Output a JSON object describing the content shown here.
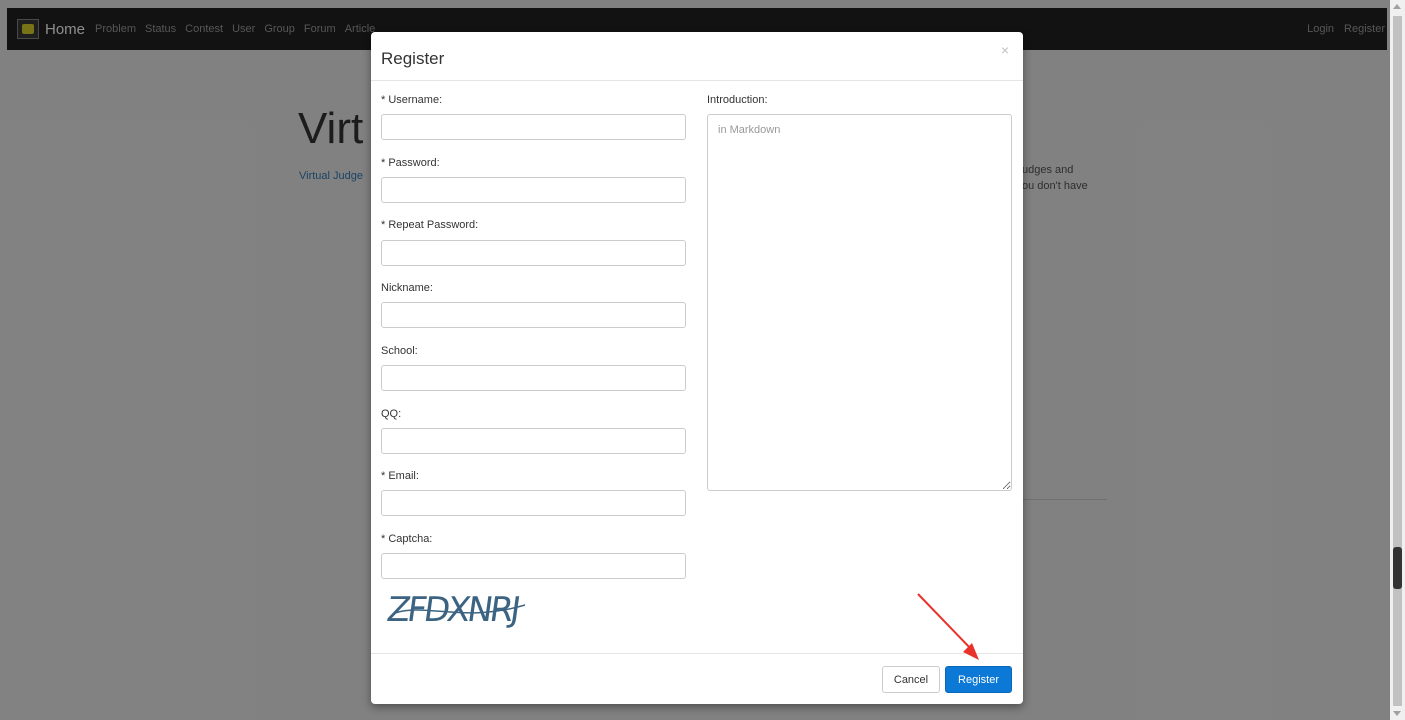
{
  "navbar": {
    "brand": "Home",
    "items": [
      "Problem",
      "Status",
      "Contest",
      "User",
      "Group",
      "Forum",
      "Article"
    ],
    "right_items": [
      "Login",
      "Register"
    ]
  },
  "background": {
    "title": "Virt",
    "description": "Virtual Judge",
    "side_line_1": "udges and",
    "side_line_2": "ou don't have"
  },
  "modal": {
    "title": "Register",
    "close": "×",
    "fields": {
      "username_label": "* Username:",
      "password_label": "* Password:",
      "repeat_password_label": "* Repeat Password:",
      "nickname_label": "Nickname:",
      "school_label": "School:",
      "qq_label": "QQ:",
      "email_label": "* Email:",
      "captcha_label": "* Captcha:",
      "introduction_label": "Introduction:",
      "introduction_placeholder": "in Markdown"
    },
    "captcha_text": "ZFDXNRJ",
    "buttons": {
      "cancel": "Cancel",
      "register": "Register"
    }
  },
  "colors": {
    "primary": "#0d79d6",
    "navbar": "#222222",
    "annotation_arrow": "#e8322b"
  }
}
